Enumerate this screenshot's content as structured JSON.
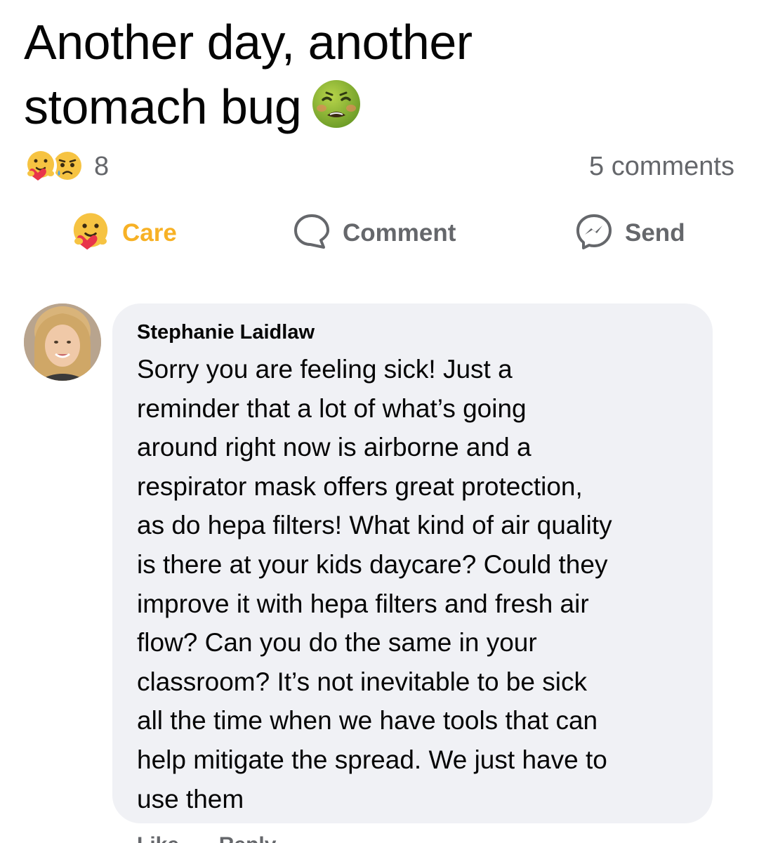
{
  "post": {
    "title_lines": [
      "Another day, another",
      "stomach bug"
    ],
    "title_emoji": "nauseated-face-emoji"
  },
  "stats": {
    "reactions": [
      "care",
      "sad"
    ],
    "reaction_count": "8",
    "comments_count": "5 comments"
  },
  "actions": {
    "care_label": "Care",
    "comment_label": "Comment",
    "send_label": "Send"
  },
  "colors": {
    "care_active": "#f7b125",
    "muted": "#65676b",
    "bubble_bg": "#f0f1f5"
  },
  "comment": {
    "author": "Stephanie Laidlaw",
    "lines": [
      "Sorry you are feeling sick! Just a",
      "reminder that a lot of what’s going",
      "around right now is airborne and a",
      "respirator mask offers great protection,",
      "as do hepa filters! What kind of air quality",
      "is there at your kids daycare? Could they",
      "improve it with hepa filters and fresh air",
      "flow? Can you do the same in your",
      "classroom? It’s not inevitable to be sick",
      "all the time when we have tools that can",
      "help mitigate the spread. We just have to",
      "use them"
    ],
    "footer_actions": [
      "Like",
      "Reply"
    ]
  }
}
